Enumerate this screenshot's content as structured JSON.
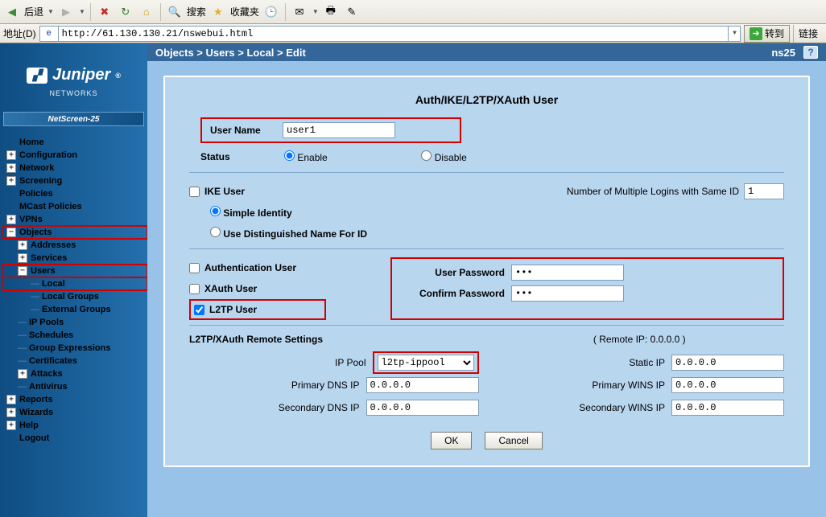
{
  "browser": {
    "back_label": "后退",
    "search_label": "搜索",
    "fav_label": "收藏夹",
    "addr_label": "地址(D)",
    "url": "http://61.130.130.21/nswebui.html",
    "go_label": "转到",
    "links_label": "链接"
  },
  "sidebar": {
    "brand": "Juniper",
    "brand_sub": "NETWORKS",
    "model": "NetScreen-25",
    "items": {
      "home": "Home",
      "configuration": "Configuration",
      "network": "Network",
      "screening": "Screening",
      "policies": "Policies",
      "mcast": "MCast Policies",
      "vpns": "VPNs",
      "objects": "Objects",
      "addresses": "Addresses",
      "services": "Services",
      "users": "Users",
      "local": "Local",
      "local_groups": "Local Groups",
      "external_groups": "External Groups",
      "ip_pools": "IP Pools",
      "schedules": "Schedules",
      "group_expr": "Group Expressions",
      "certificates": "Certificates",
      "attacks": "Attacks",
      "antivirus": "Antivirus",
      "reports": "Reports",
      "wizards": "Wizards",
      "help": "Help",
      "logout": "Logout"
    }
  },
  "header": {
    "breadcrumb": "Objects > Users > Local > Edit",
    "device": "ns25"
  },
  "form": {
    "title": "Auth/IKE/L2TP/XAuth User",
    "username_label": "User Name",
    "username_value": "user1",
    "status_label": "Status",
    "enable_label": "Enable",
    "disable_label": "Disable",
    "ike_user_label": "IKE User",
    "multi_login_label": "Number of Multiple Logins with Same ID",
    "multi_login_value": "1",
    "simple_identity_label": "Simple Identity",
    "dn_label": "Use Distinguished Name For ID",
    "auth_user_label": "Authentication User",
    "xauth_user_label": "XAuth User",
    "l2tp_user_label": "L2TP User",
    "user_pw_label": "User Password",
    "confirm_pw_label": "Confirm Password",
    "pw_value": "•••",
    "remote_title": "L2TP/XAuth Remote Settings",
    "remote_ip_label": "( Remote IP: 0.0.0.0 )",
    "ippool_label": "IP Pool",
    "ippool_value": "l2tp-ippool",
    "static_ip_label": "Static IP",
    "static_ip_value": "0.0.0.0",
    "primary_dns_label": "Primary DNS IP",
    "primary_dns_value": "0.0.0.0",
    "primary_wins_label": "Primary WINS IP",
    "primary_wins_value": "0.0.0.0",
    "secondary_dns_label": "Secondary DNS IP",
    "secondary_dns_value": "0.0.0.0",
    "secondary_wins_label": "Secondary WINS IP",
    "secondary_wins_value": "0.0.0.0",
    "ok_label": "OK",
    "cancel_label": "Cancel"
  }
}
